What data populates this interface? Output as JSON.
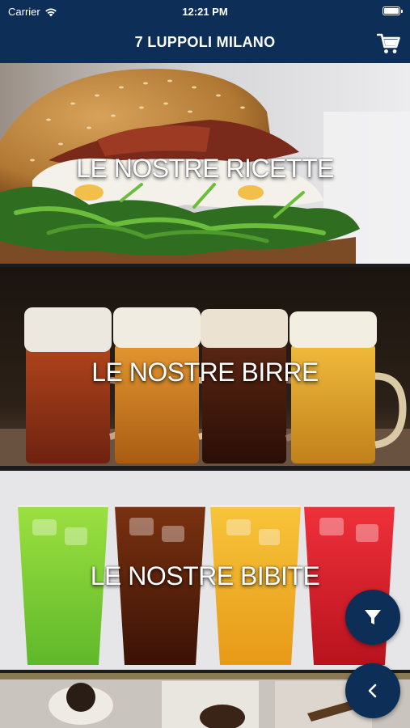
{
  "status": {
    "carrier": "Carrier",
    "time": "12:21 PM"
  },
  "navbar": {
    "title": "7 LUPPOLI MILANO"
  },
  "categories": [
    {
      "label": "LE NOSTRE RICETTE"
    },
    {
      "label": "LE NOSTRE BIRRE"
    },
    {
      "label": "LE NOSTRE BIBITE"
    }
  ],
  "colors": {
    "bar": "#0d2e57",
    "fab": "#0d2e57",
    "text": "#ffffff"
  },
  "icons": {
    "cart": "cart-icon",
    "filter": "filter-icon",
    "back": "chevron-left-icon",
    "wifi": "wifi-icon",
    "battery": "battery-icon"
  }
}
